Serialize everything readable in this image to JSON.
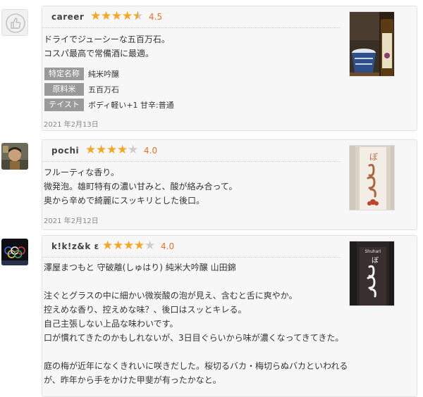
{
  "reviews": [
    {
      "user": "career",
      "score": "4.5",
      "rating": 4.5,
      "body_lines": [
        "ドライでジューシーな五百万石。",
        "コスパ最高で常備酒に最適。"
      ],
      "tags": [
        {
          "label": "特定名称",
          "value": "純米吟醸"
        },
        {
          "label": "原料米",
          "value": "五百万石"
        },
        {
          "label": "テイスト",
          "value": "ボディ軽い+1  甘辛:普通"
        }
      ],
      "date": "2021 年2月13日"
    },
    {
      "user": "pochi",
      "score": "4.0",
      "rating": 4,
      "body_lines": [
        "フルーティな香り。",
        "微発泡。雄町特有の濃い甘みと、酸が絡み合って。",
        "奥から辛めで綺麗にスッキリとした後口。"
      ],
      "date": "2021 年2月12日"
    },
    {
      "user": "k!k!z&k ε",
      "score": "4.0",
      "rating": 4,
      "body_lines": [
        "澤屋まつもと 守破離(しゅはり) 純米大吟醸 山田錦",
        "",
        "注ぐとグラスの中に細かい微炭酸の泡が見え、含むと舌に爽やか。",
        "控えめな香り、控えめな味？、後口はスッとキレる。",
        "自己主張しない上品な味わいです。",
        "口が慣れてきたのかもしれないが、3日目ぐらいから味が濃くなってきてきた。",
        "",
        "庭の梅が近年になくきれいに咲きだした。桜切るバカ・梅切らぬバカといわれる",
        "が、昨年から手をかけた甲斐が有ったかなと。"
      ],
      "photo_label": "Shuhari"
    }
  ],
  "colors": {
    "star": "#f5a623",
    "star_empty": "#cccccc",
    "score": "#e8732c",
    "tag_bg": "#9a9a9a"
  }
}
